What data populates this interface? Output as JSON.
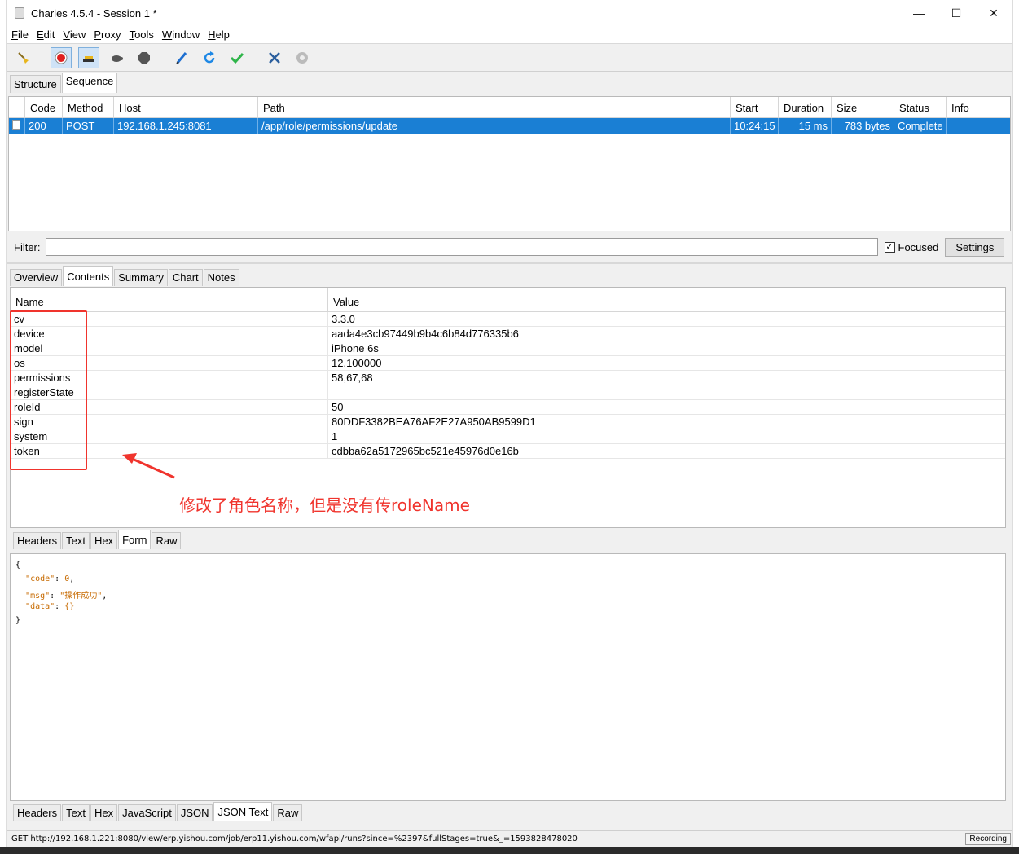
{
  "window": {
    "title": "Charles 4.5.4 - Session 1 *",
    "controls": [
      "—",
      "☐",
      "✕"
    ]
  },
  "menu": [
    {
      "key": "F",
      "rest": "ile"
    },
    {
      "key": "E",
      "rest": "dit"
    },
    {
      "key": "V",
      "rest": "iew"
    },
    {
      "key": "P",
      "rest": "roxy"
    },
    {
      "key": "T",
      "rest": "ools"
    },
    {
      "key": "W",
      "rest": "indow"
    },
    {
      "key": "H",
      "rest": "elp"
    }
  ],
  "toolbar_icons": [
    "broom-icon",
    "record-icon",
    "throttle-icon",
    "turtle-icon",
    "stop-icon",
    "pen-icon",
    "refresh-icon",
    "check-icon",
    "tools-icon",
    "settings-gear-icon"
  ],
  "top_tabs": [
    "Structure",
    "Sequence"
  ],
  "sequence": {
    "columns": [
      "Code",
      "Method",
      "Host",
      "Path",
      "Start",
      "Duration",
      "Size",
      "Status",
      "Info"
    ],
    "rows": [
      {
        "code": "200",
        "method": "POST",
        "host": "192.168.1.245:8081",
        "path": "/app/role/permissions/update",
        "start": "10:24:15",
        "duration": "15 ms",
        "size": "783 bytes",
        "status": "Complete",
        "info": ""
      }
    ]
  },
  "filter": {
    "label": "Filter:",
    "value": "",
    "focused_label": "Focused",
    "focused_checked": true,
    "settings_label": "Settings"
  },
  "detail_tabs": [
    "Overview",
    "Contents",
    "Summary",
    "Chart",
    "Notes"
  ],
  "form": {
    "columns": [
      "Name",
      "Value"
    ],
    "rows": [
      {
        "name": "cv",
        "value": "3.3.0"
      },
      {
        "name": "device",
        "value": "aada4e3cb97449b9b4c6b84d776335b6"
      },
      {
        "name": "model",
        "value": "iPhone 6s"
      },
      {
        "name": "os",
        "value": "12.100000"
      },
      {
        "name": "permissions",
        "value": "58,67,68"
      },
      {
        "name": "registerState",
        "value": ""
      },
      {
        "name": "roleId",
        "value": "50"
      },
      {
        "name": "sign",
        "value": "80DDF3382BEA76AF2E27A950AB9599D1"
      },
      {
        "name": "system",
        "value": "1"
      },
      {
        "name": "token",
        "value": "cdbba62a5172965bc521e45976d0e16b"
      }
    ]
  },
  "annotation": "修改了角色名称，但是没有传roleName",
  "request_tabs": [
    "Headers",
    "Text",
    "Hex",
    "Form",
    "Raw"
  ],
  "response": {
    "lines": [
      {
        "pre": "{",
        "key": "",
        "mid": "",
        "val": "",
        "post": ""
      },
      {
        "pre": "  ",
        "key": "\"code\"",
        "mid": ": ",
        "val": "0",
        "post": ","
      },
      {
        "pre": "  ",
        "key": "\"msg\"",
        "mid": ": ",
        "val": "\"操作成功\"",
        "post": ","
      },
      {
        "pre": "  ",
        "key": "\"data\"",
        "mid": ": ",
        "val": "{}",
        "post": ""
      },
      {
        "pre": "}",
        "key": "",
        "mid": "",
        "val": "",
        "post": ""
      }
    ]
  },
  "response_tabs": [
    "Headers",
    "Text",
    "Hex",
    "JavaScript",
    "JSON",
    "JSON Text",
    "Raw"
  ],
  "status": {
    "url": "GET http://192.168.1.221:8080/view/erp.yishou.com/job/erp11.yishou.com/wfapi/runs?since=%2397&fullStages=true&_=1593828478020",
    "recording": "Recording"
  }
}
